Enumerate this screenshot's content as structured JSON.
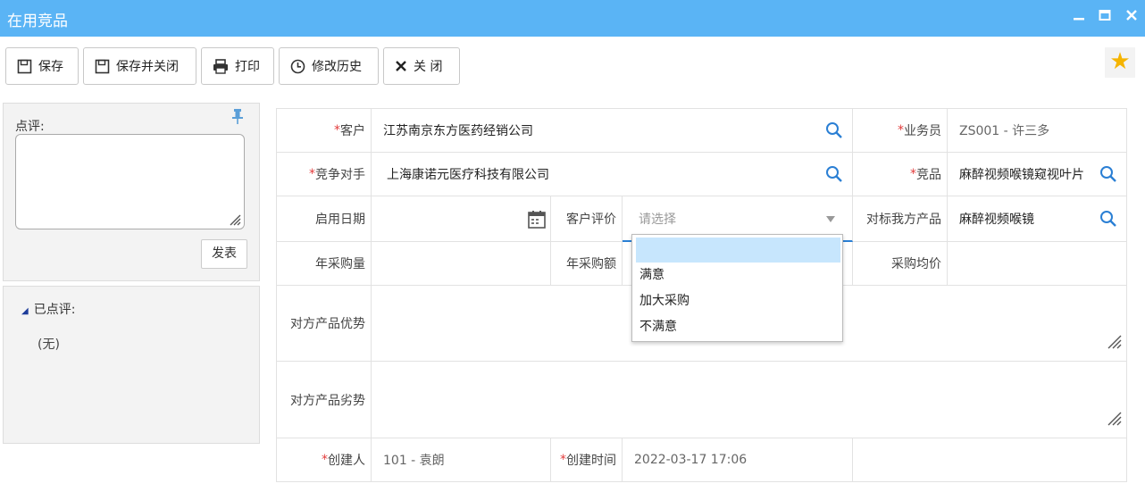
{
  "window": {
    "title": "在用竞品",
    "min_icon": "minimize-icon",
    "max_icon": "maximize-icon",
    "close_icon": "close-icon"
  },
  "toolbar": {
    "save": "保存",
    "save_close": "保存并关闭",
    "print": "打印",
    "history": "修改历史",
    "close": "关 闭"
  },
  "comment": {
    "label": "点评:",
    "post": "发表"
  },
  "comments": {
    "header": "已点评:",
    "empty": "(无)"
  },
  "form": {
    "required_mark": "*",
    "customer_label": "客户",
    "customer_value": "江苏南京东方医药经销公司",
    "salesman_label": "业务员",
    "salesman_value": "ZS001 - 许三多",
    "competitor_label": "竞争对手",
    "competitor_value": "上海康诺元医疗科技有限公司",
    "product_label": "竞品",
    "product_value": "麻醉视频喉镜窥视叶片",
    "start_date_label": "启用日期",
    "rating_label": "客户评价",
    "rating_placeholder": "请选择",
    "benchmark_label": "对标我方产品",
    "benchmark_value": "麻醉视频喉镜",
    "annual_qty_label": "年采购量",
    "annual_amount_label": "年采购额",
    "avg_price_label": "采购均价",
    "advantage_label": "对方产品优势",
    "disadvantage_label": "对方产品劣势",
    "creator_label": "创建人",
    "creator_value": "101 - 袁朗",
    "created_time_label": "创建时间",
    "created_time_value": "2022-03-17 17:06"
  },
  "rating_options": [
    "",
    "满意",
    "加大采购",
    "不满意"
  ],
  "colors": {
    "titlebar": "#5ab4f5",
    "required": "#e23b3b",
    "search_icon": "#2a7fd4",
    "star": "#f5b400",
    "selected_option": "#c7e6fd"
  }
}
